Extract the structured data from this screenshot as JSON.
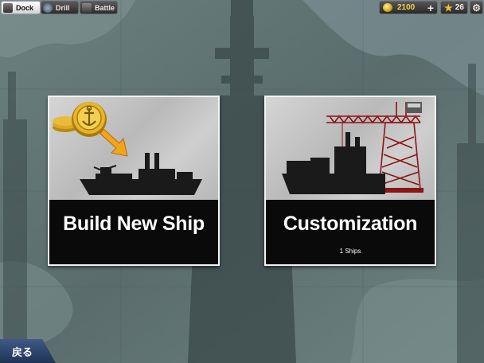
{
  "tabs": [
    {
      "label": "Dock",
      "icon": "dock-icon",
      "active": true
    },
    {
      "label": "Drill",
      "icon": "drill-icon",
      "active": false
    },
    {
      "label": "Battle",
      "icon": "battle-icon",
      "active": false
    }
  ],
  "resources": {
    "coins": "2100",
    "coin_icon": "coin-icon",
    "plus_label": "+",
    "stars": "26",
    "star_icon": "star-icon",
    "settings_icon": "gear-icon"
  },
  "cards": {
    "build": {
      "title": "Build New Ship",
      "icon": "coin-to-ship-icon"
    },
    "custom": {
      "title": "Customization",
      "subtitle": "1 Ships",
      "icon": "crane-ship-icon"
    }
  },
  "back_button": {
    "label": "戻る"
  },
  "colors": {
    "gold": "#f5d14a",
    "back": "#2c4570",
    "card_bg": "#0a0a0a"
  }
}
